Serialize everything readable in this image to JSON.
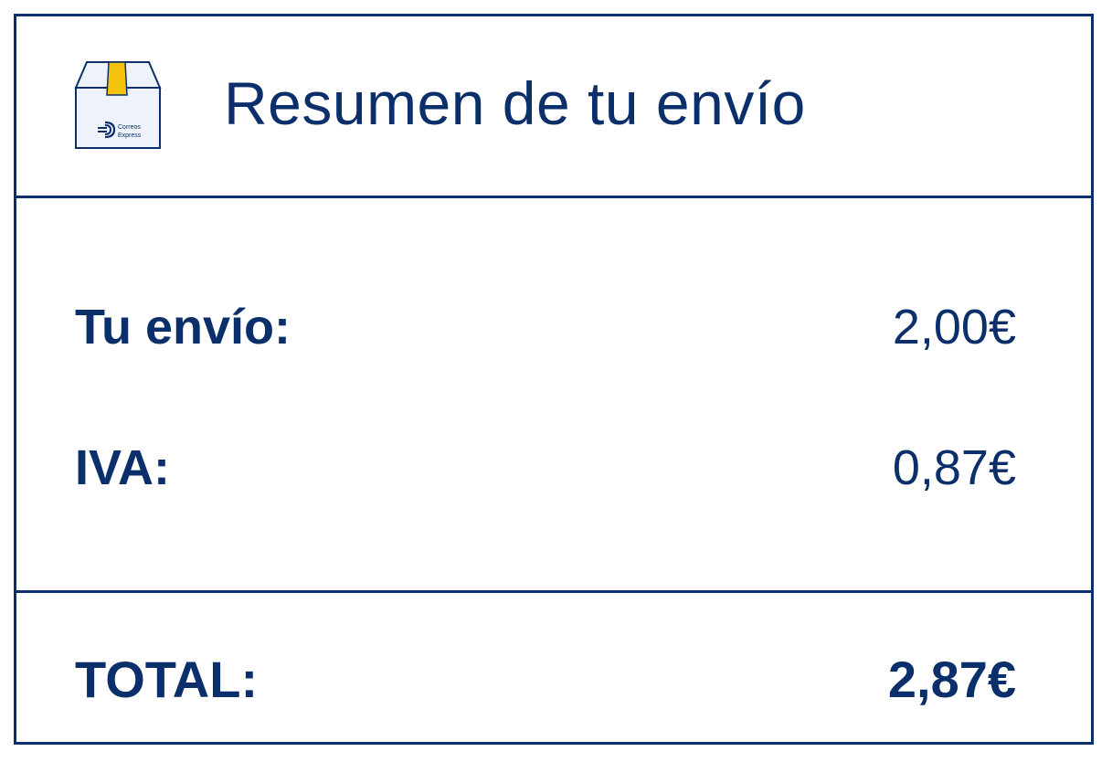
{
  "header": {
    "title": "Resumen de tu envío",
    "icon": "package-box-icon",
    "logo_text_line1": "Correos",
    "logo_text_line2": "Express"
  },
  "summary": {
    "shipping_label": "Tu envío:",
    "shipping_value": "2,00€",
    "vat_label": "IVA:",
    "vat_value": "0,87€",
    "total_label": "TOTAL:",
    "total_value": "2,87€"
  },
  "colors": {
    "primary": "#0b2f6b",
    "accent_yellow": "#f4c20d",
    "box_fill": "#eef3fb"
  }
}
